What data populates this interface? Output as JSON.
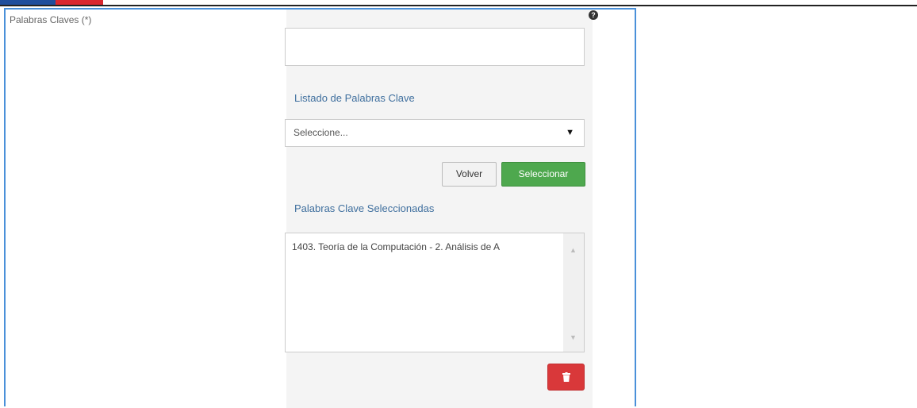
{
  "brand": {
    "colors": {
      "flag_blue": "#1f4e9c",
      "flag_red": "#d9272e",
      "panel_border": "#4a90d9",
      "select_button": "#4ea84e",
      "delete_button": "#d9383a"
    }
  },
  "form": {
    "field_label": "Palabras Claves (*)",
    "help_icon": "question-circle-icon",
    "keyword_input": {
      "value": "",
      "placeholder": ""
    },
    "list_title": "Listado de Palabras Clave",
    "select": {
      "selected": "Seleccione..."
    },
    "buttons": {
      "back": "Volver",
      "select": "Seleccionar",
      "delete_icon": "trash-icon"
    },
    "selected_title": "Palabras Clave Seleccionadas",
    "selected_items": [
      "1403. Teoría de la Computación - 2. Análisis de A"
    ]
  }
}
